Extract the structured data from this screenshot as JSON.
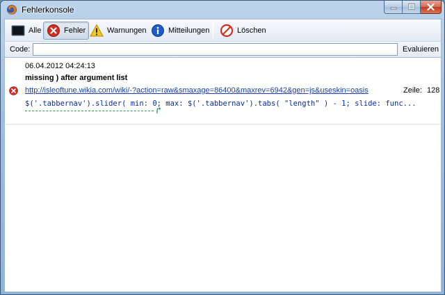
{
  "window": {
    "title": "Fehlerkonsole"
  },
  "toolbar": {
    "alle": "Alle",
    "fehler": "Fehler",
    "warnungen": "Warnungen",
    "mitteilungen": "Mitteilungen",
    "loeschen": "Löschen"
  },
  "codebar": {
    "label": "Code:",
    "value": "",
    "evaluate": "Evaluieren"
  },
  "entries": [
    {
      "timestamp": "06.04.2012 04:24:13",
      "message": "missing ) after argument list",
      "source": "http://isleoftune.wikia.com/wiki/-?action=raw&smaxage=86400&maxrev=6942&gen=js&useskin=oasis",
      "line_label": "Zeile:",
      "line": "128",
      "code": "$('.tabbernav').slider( min: 0; max: $('.tabbernav').tabs( \"length\" ) - 1; slide: func..."
    }
  ],
  "colors": {
    "error_red": "#d42c20",
    "link_blue": "#1a3fb0",
    "code_blue": "#0a2aa8",
    "pointer_green": "#2a9a4a"
  },
  "icons": [
    "firefox-icon",
    "console-icon",
    "error-icon",
    "warning-icon",
    "info-icon",
    "clear-icon",
    "minimize-icon",
    "maximize-icon",
    "close-icon"
  ]
}
